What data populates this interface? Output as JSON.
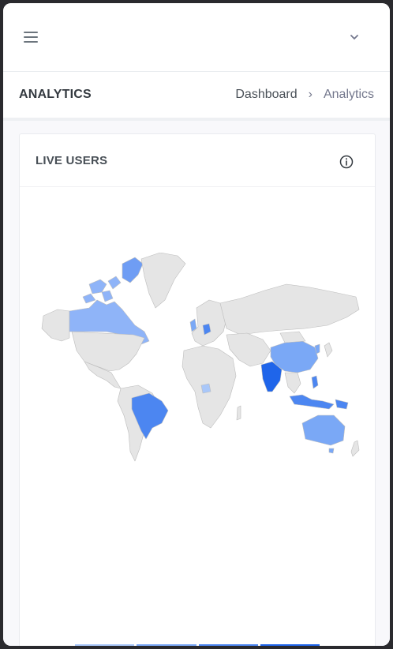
{
  "header": {
    "menu_icon": "hamburger-icon",
    "dropdown_icon": "chevron-down-icon"
  },
  "page": {
    "title": "ANALYTICS",
    "breadcrumb": {
      "parent": "Dashboard",
      "separator": "›",
      "current": "Analytics"
    }
  },
  "card": {
    "title": "LIVE USERS",
    "info_icon": "info-icon"
  },
  "map": {
    "highlighted_countries": [
      "Canada",
      "Greenland",
      "United States",
      "Brazil",
      "India",
      "China",
      "Australia",
      "Indonesia",
      "Malaysia",
      "Philippines",
      "Germany",
      "United Kingdom",
      "Nigeria"
    ],
    "legend_colors": [
      "#a9c7f9",
      "#7aa8f6",
      "#4c86f1",
      "#1f65ea"
    ]
  },
  "colors": {
    "brand_blue": "#4f8ef7",
    "dark_blue": "#2f6fe8",
    "land_default": "#e5e5e5",
    "border": "#bdbdbd"
  }
}
